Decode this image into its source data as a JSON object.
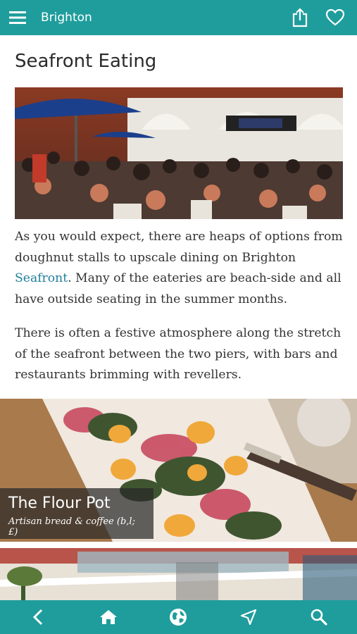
{
  "topbar": {
    "title": "Brighton",
    "menu_icon": "hamburger-menu-icon",
    "share_icon": "share-icon",
    "favorite_icon": "heart-icon"
  },
  "article": {
    "heading": "Seafront Eating",
    "hero_image_icon": "photo-seafront-crowd",
    "para1_before": "As you would expect, there are heaps of options from doughnut stalls to upscale dining on Brighton ",
    "para1_link": "Seafront",
    "para1_after": ". Many of the eateries are beach-side and all have outside seating in the summer months.",
    "para2": "There is often a festive atmosphere along the stretch of the seafront between the two piers, with bars and restaurants brimming with revellers."
  },
  "cards": [
    {
      "title": "The Flour Pot",
      "subtitle": "Artisan bread & coffee (b,l; £)"
    }
  ],
  "bottombar": {
    "items": [
      {
        "icon": "back-icon"
      },
      {
        "icon": "home-icon"
      },
      {
        "icon": "globe-icon"
      },
      {
        "icon": "navigate-icon"
      },
      {
        "icon": "search-icon"
      }
    ]
  },
  "colors": {
    "brand": "#1f9d9c",
    "link": "#1f7f9c",
    "text": "#333333"
  }
}
